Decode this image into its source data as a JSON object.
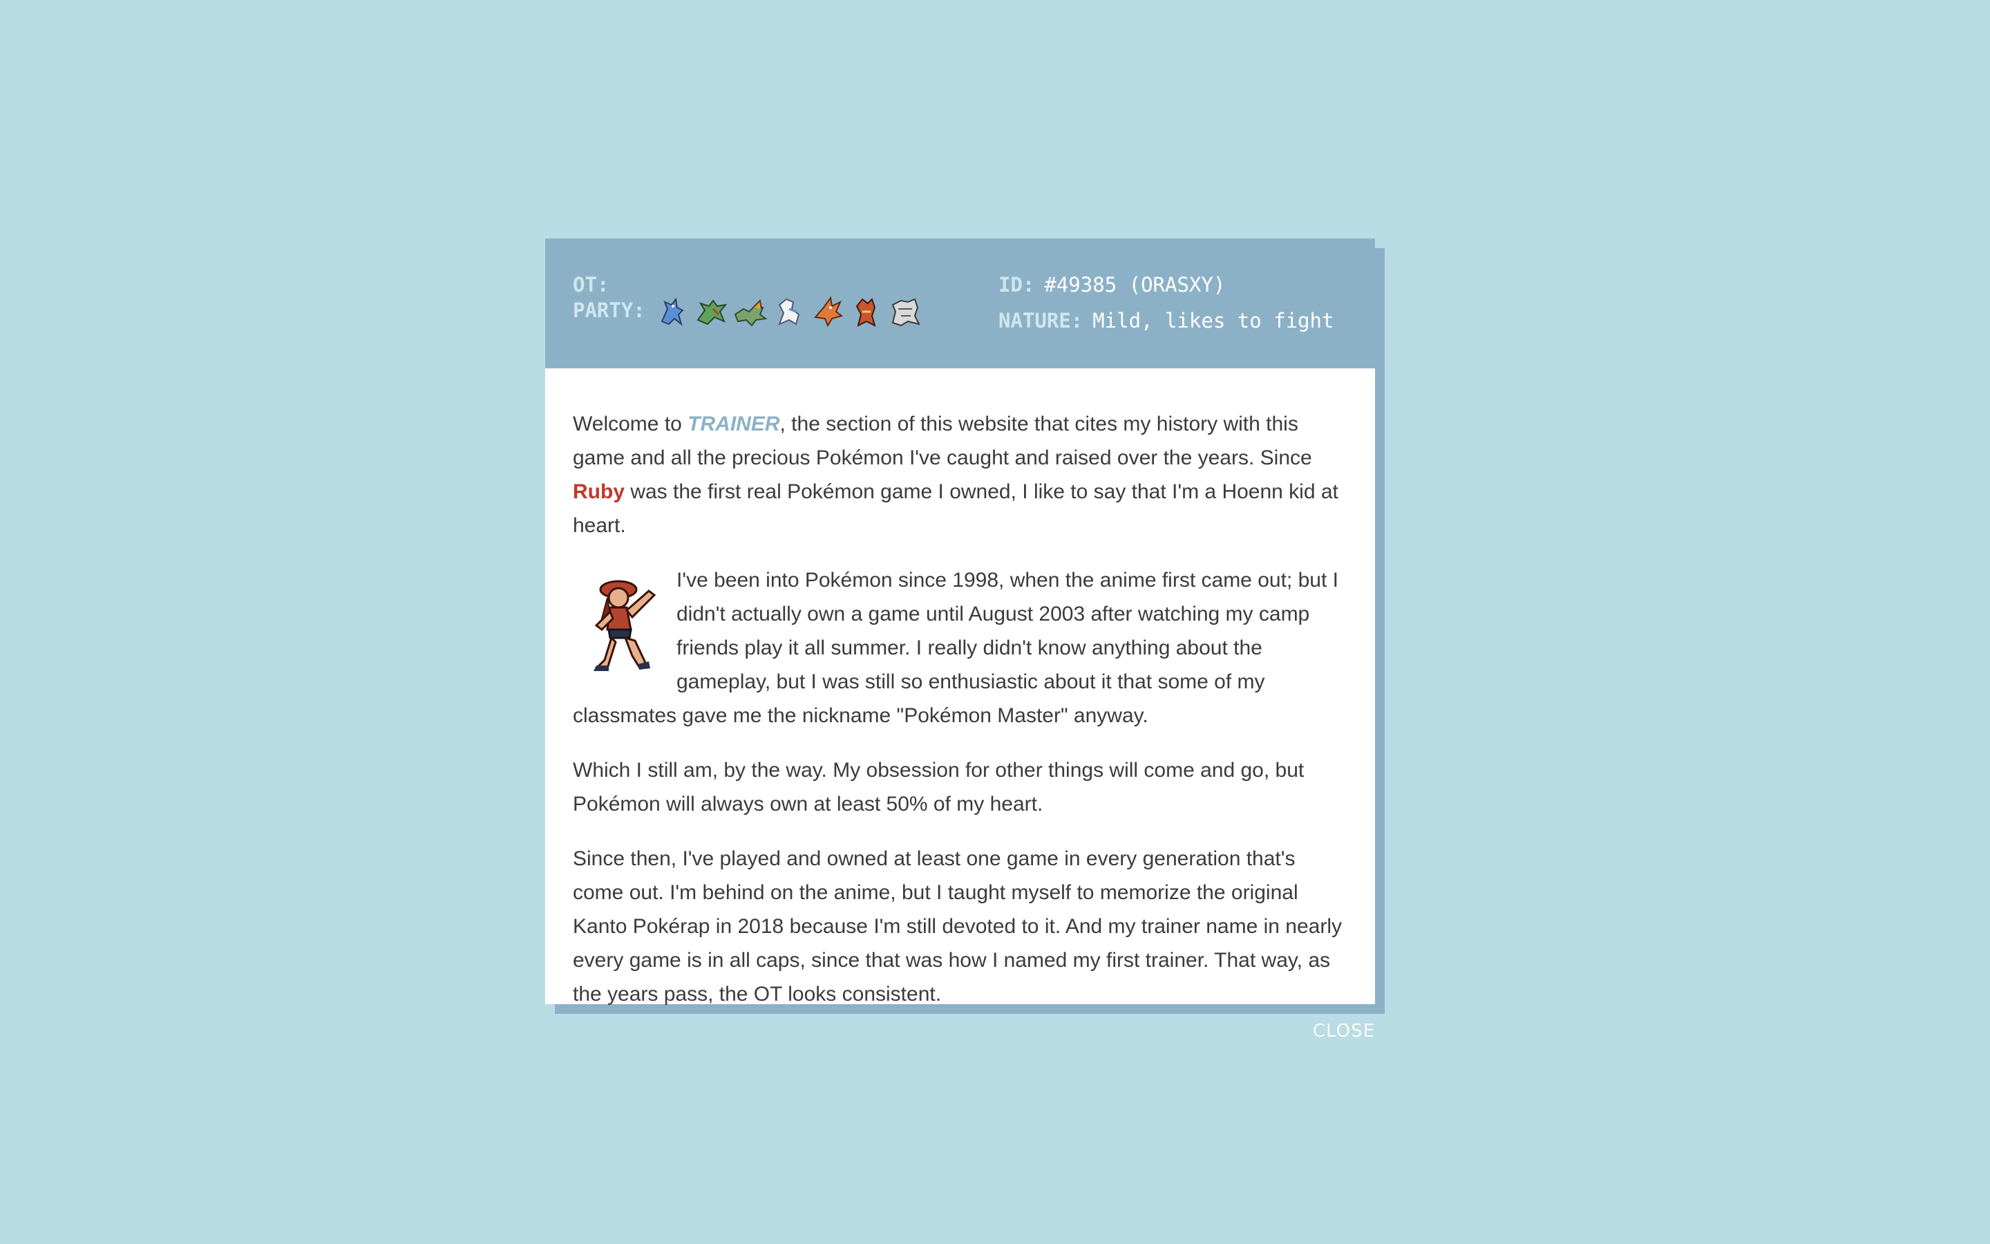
{
  "header": {
    "ot_label": "OT:",
    "party_label": "PARTY:",
    "id_label": "ID:",
    "id_value": "#49385 (ORASXY)",
    "nature_label": "NATURE:",
    "nature_value": "Mild, likes to fight",
    "party_sprites": [
      "blue-lizard-sprite",
      "green-gecko-sprite",
      "dragon-sprite",
      "white-dragon-sprite",
      "orange-bird-sprite",
      "fox-sprite",
      "armor-sprite"
    ]
  },
  "body": {
    "p1_a": "Welcome to ",
    "p1_trainer": "TRAINER",
    "p1_b": ", the section of this website that cites my history with this game and all the precious Pokémon I've caught and raised over the years. Since ",
    "p1_ruby": "Ruby",
    "p1_c": " was the first real Pokémon game I owned, I like to say that I'm a Hoenn kid at heart.",
    "p2": "I've been into Pokémon since 1998, when the anime first came out; but I didn't actually own a game until August 2003 after watching my camp friends play it all summer. I really didn't know anything about the gameplay, but I was still so enthusiastic about it that some of my classmates gave me the nickname \"Pokémon Master\" anyway.",
    "p3": "Which I still am, by the way. My obsession for other things will come and go, but Pokémon will always own at least 50% of my heart.",
    "p4": "Since then, I've played and owned at least one game in every generation that's come out. I'm behind on the anime, but I taught myself to memorize the original Kanto Pokérap in 2018 because I'm still devoted to it. And my trainer name in nearly every game is in all caps, since that was how I named my first trainer. That way, as the years pass, the OT looks consistent."
  },
  "close_label": "CLOSE",
  "colors": {
    "background": "#badde5",
    "header": "#8cb1c7",
    "ruby": "#c0392b",
    "text": "#3b3b3b"
  }
}
